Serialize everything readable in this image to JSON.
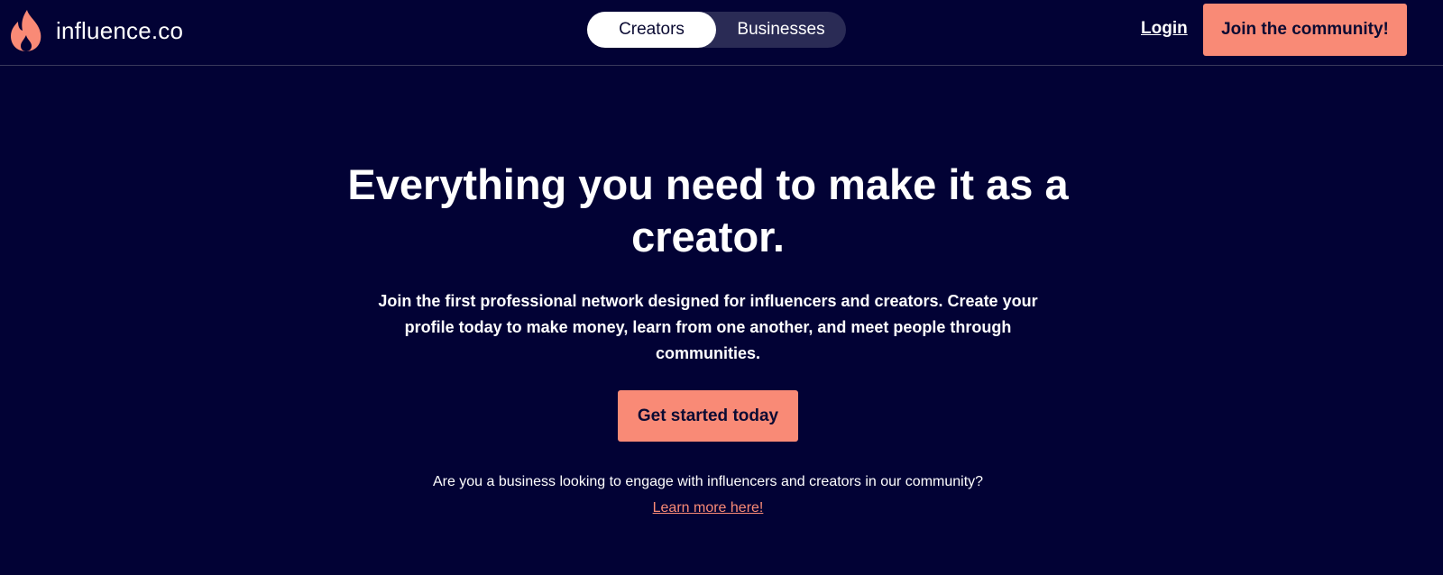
{
  "brand": {
    "name": "influence.co",
    "logo_icon": "flame-icon",
    "accent_color": "#f98a76"
  },
  "nav": {
    "toggle": {
      "options": [
        "Creators",
        "Businesses"
      ],
      "selected": "Creators"
    },
    "login_label": "Login",
    "join_label": "Join the community!"
  },
  "hero": {
    "title": "Everything you need to make it as a creator.",
    "subtitle": "Join the first professional network designed for influencers and creators. Create your profile today to make money, learn from one another, and meet people through communities.",
    "cta_label": "Get started today",
    "business_question": "Are you a business looking to engage with influencers and creators in our community?",
    "business_link": "Learn more here!"
  },
  "colors": {
    "background": "#020235",
    "button": "#f98a76",
    "toggle_bg": "#2a2b55"
  }
}
